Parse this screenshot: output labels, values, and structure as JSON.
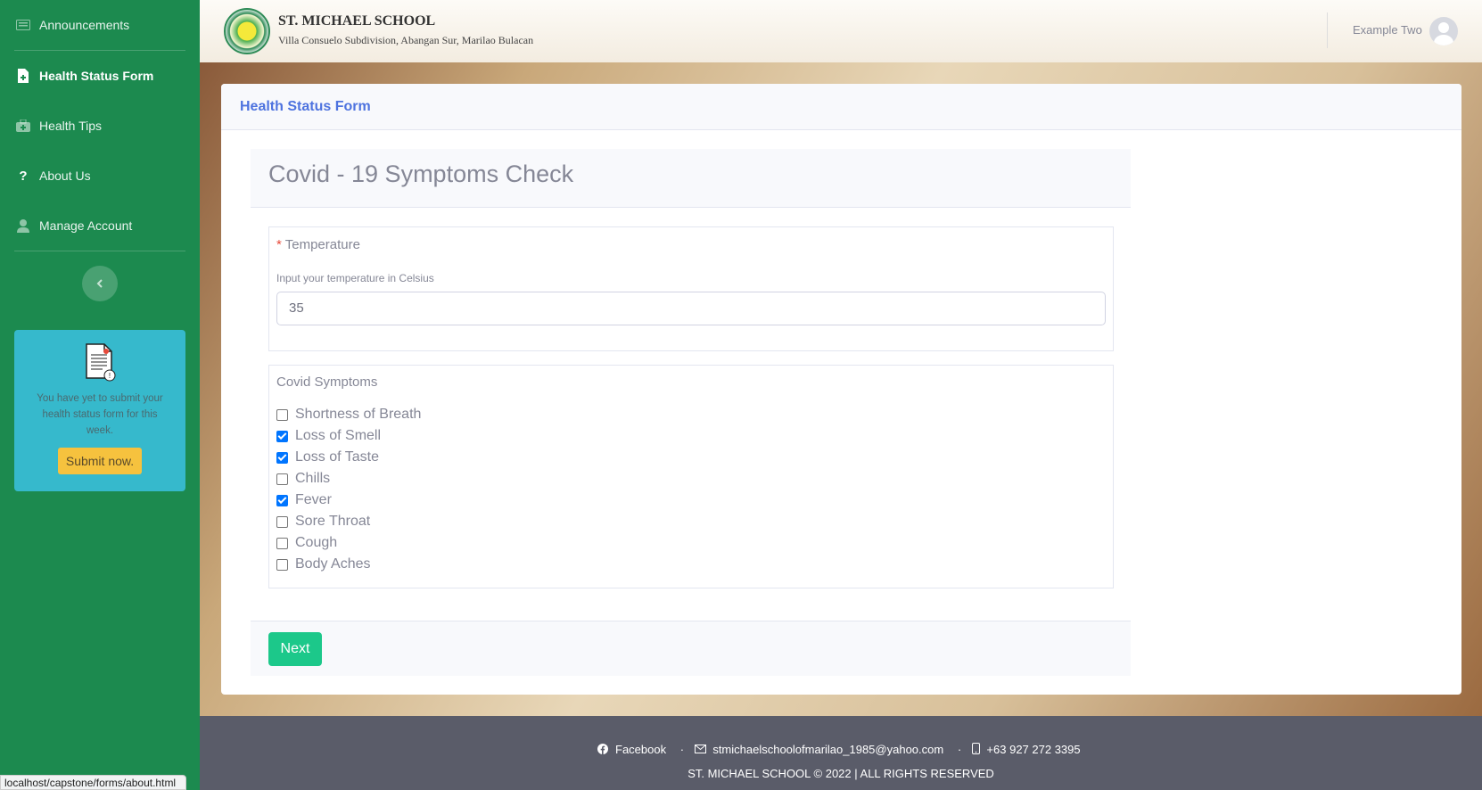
{
  "sidebar": {
    "items": [
      {
        "label": "Announcements",
        "icon": "newspaper-icon"
      },
      {
        "label": "Health Status Form",
        "icon": "file-medical-icon",
        "active": true
      },
      {
        "label": "Health Tips",
        "icon": "medkit-icon"
      },
      {
        "label": "About Us",
        "icon": "question-icon"
      },
      {
        "label": "Manage Account",
        "icon": "user-icon"
      }
    ],
    "reminder": {
      "text": "You have yet to submit your health status form for this week.",
      "button": "Submit now."
    }
  },
  "header": {
    "school_name": "ST. MICHAEL SCHOOL",
    "address": "Villa Consuelo Subdivision, Abangan Sur, Marilao Bulacan",
    "user_name": "Example Two"
  },
  "card": {
    "title": "Health Status Form",
    "form_title": "Covid - 19 Symptoms Check",
    "temperature": {
      "required_mark": "*",
      "label": "Temperature",
      "hint": "Input your temperature in Celsius",
      "value": "35"
    },
    "symptoms": {
      "label": "Covid Symptoms",
      "options": [
        {
          "label": "Shortness of Breath",
          "checked": false
        },
        {
          "label": "Loss of Smell",
          "checked": true
        },
        {
          "label": "Loss of Taste",
          "checked": true
        },
        {
          "label": "Chills",
          "checked": false
        },
        {
          "label": "Fever",
          "checked": true
        },
        {
          "label": "Sore Throat",
          "checked": false
        },
        {
          "label": "Cough",
          "checked": false
        },
        {
          "label": "Body Aches",
          "checked": false
        }
      ]
    },
    "next_label": "Next"
  },
  "footer": {
    "facebook": "Facebook",
    "email": "stmichaelschoolofmarilao_1985@yahoo.com",
    "phone": "+63 927 272 3395",
    "separator": "·",
    "copyright": "ST. MICHAEL SCHOOL © 2022 | ALL RIGHTS RESERVED"
  },
  "status_url": "localhost/capstone/forms/about.html"
}
